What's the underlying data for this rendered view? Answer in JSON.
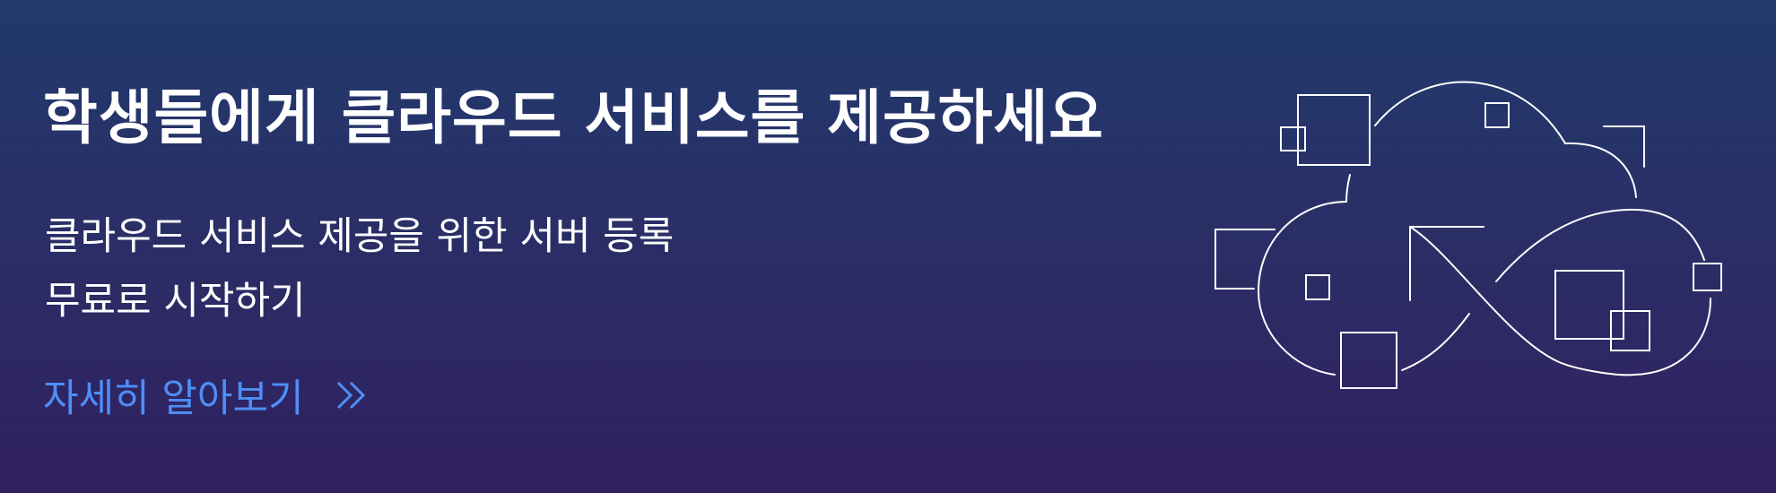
{
  "banner": {
    "headline": "학생들에게 클라우드 서비스를 제공하세요",
    "subtext_lines": [
      "클라우드 서비스 제공을 위한 서버 등록",
      "무료로 시작하기"
    ],
    "cta": {
      "label": "자세히 알아보기",
      "icon": "double-chevron-right-icon"
    },
    "illustration": "cloud-infinity-illustration"
  },
  "colors": {
    "background_top": "#203a6d",
    "background_bottom": "#312060",
    "text": "#ffffff",
    "accent": "#4f8ef7"
  }
}
